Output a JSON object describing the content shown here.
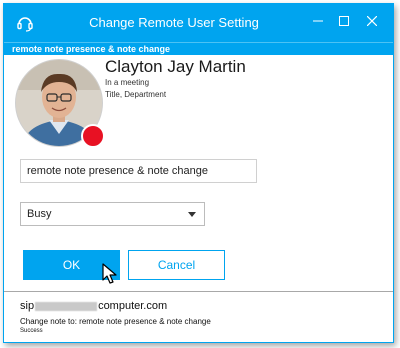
{
  "window": {
    "title": "Change Remote User Setting",
    "subheader": "remote note presence & note change"
  },
  "user": {
    "name": "Clayton Jay Martin",
    "status": "In a meeting",
    "title_department": "Title, Department",
    "presence_color": "#e81123"
  },
  "form": {
    "note_value": "remote note presence & note change",
    "status_selected": "Busy"
  },
  "buttons": {
    "ok_label": "OK",
    "cancel_label": "Cancel"
  },
  "log": {
    "sip_prefix": "sip",
    "sip_suffix": "computer.com",
    "note_line": "Change note to: remote note presence & note change",
    "result": "Success"
  },
  "colors": {
    "accent": "#00a4ef",
    "busy": "#e81123"
  },
  "icons": {
    "app": "headset-icon",
    "minimize": "minimize-icon",
    "maximize": "maximize-icon",
    "close": "close-icon",
    "caret": "chevron-down-icon",
    "cursor": "mouse-pointer-icon"
  }
}
